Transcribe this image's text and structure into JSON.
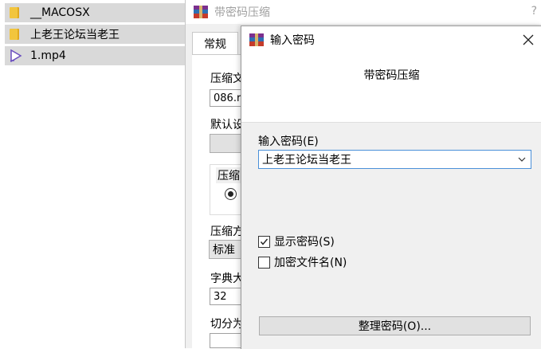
{
  "file_list": [
    {
      "name": "__MACOSX",
      "icon": "folder-icon"
    },
    {
      "name": "上老王论坛当老王",
      "icon": "folder-icon"
    },
    {
      "name": "1.mp4",
      "icon": "video-file-icon"
    }
  ],
  "background_dialog": {
    "title": "带密码压缩",
    "help": "?",
    "tab_general": "常规",
    "label_archive_name": "压缩文",
    "archive_name_value": "086.r",
    "label_default": "默认设",
    "label_format": "压缩",
    "label_method": "压缩方",
    "method_value": "标准",
    "label_dict": "字典大",
    "dict_value": "32",
    "label_split": "切分为"
  },
  "password_dialog": {
    "title": "输入密码",
    "subtitle": "带密码压缩",
    "password_label": "输入密码(E)",
    "password_value": "上老王论坛当老王",
    "show_password_label": "显示密码(S)",
    "show_password_checked": true,
    "encrypt_names_label": "加密文件名(N)",
    "encrypt_names_checked": false,
    "organize_button": "整理密码(O)..."
  },
  "colors": {
    "selection": "#d9d9d9",
    "focus_border": "#4a90d9",
    "folder": "#f2c53d",
    "video_icon": "#6b4fbf"
  }
}
